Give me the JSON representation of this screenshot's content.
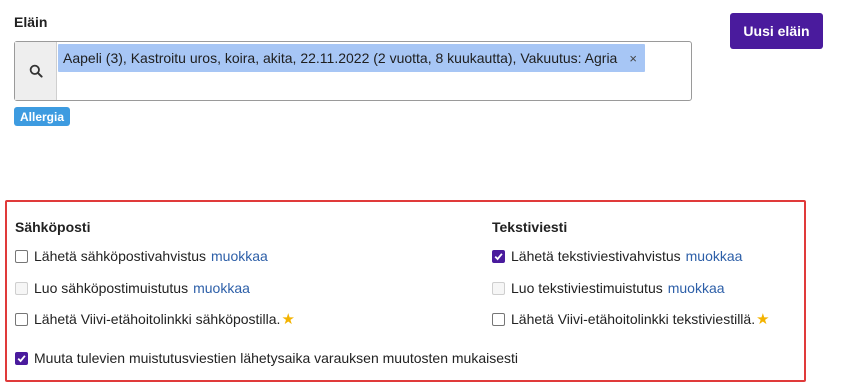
{
  "animal": {
    "label": "Eläin",
    "new_button": "Uusi eläin",
    "selected_chip": "Aapeli (3), Kastroitu uros, koira, akita, 22.11.2022 (2 vuotta, 8 kuukautta), Vakuutus: Agria",
    "chip_remove": "×",
    "allergy_badge": "Allergia"
  },
  "notifications": {
    "email": {
      "heading": "Sähköposti",
      "options": [
        {
          "label": "Lähetä sähköpostivahvistus",
          "link": "muokkaa",
          "checked": false,
          "disabled": false
        },
        {
          "label": "Luo sähköpostimuistutus",
          "link": "muokkaa",
          "checked": false,
          "disabled": true
        },
        {
          "label": "Lähetä Viivi-etähoitolinkki sähköpostilla.",
          "checked": false,
          "disabled": false,
          "star": "★"
        }
      ]
    },
    "sms": {
      "heading": "Tekstiviesti",
      "options": [
        {
          "label": "Lähetä tekstiviestivahvistus",
          "link": "muokkaa",
          "checked": true,
          "disabled": false
        },
        {
          "label": "Luo tekstiviestimuistutus",
          "link": "muokkaa",
          "checked": false,
          "disabled": true
        },
        {
          "label": "Lähetä Viivi-etähoitolinkki tekstiviestillä.",
          "checked": false,
          "disabled": false,
          "star": "★"
        }
      ]
    },
    "reschedule": {
      "label": "Muuta tulevien muistutusviestien lähetysaika varauksen muutosten mukaisesti",
      "checked": true
    }
  },
  "colors": {
    "primary": "#4a1b9d",
    "chip": "#a7c6f5",
    "badge": "#3d9be0",
    "link": "#2d5fa8",
    "highlight_border": "#e03a3a",
    "star": "#f3b300"
  }
}
